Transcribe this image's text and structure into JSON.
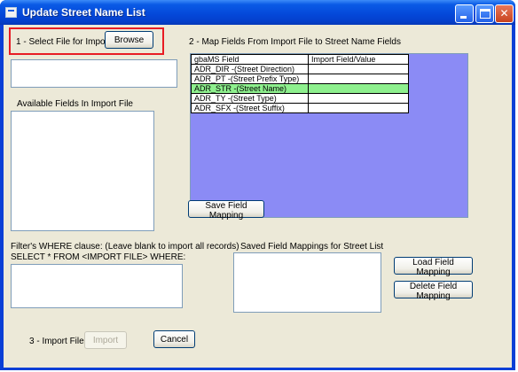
{
  "window": {
    "title": "Update Street Name List"
  },
  "step1": {
    "label": "1 - Select File for Import:",
    "browse_label": "Browse",
    "file_value": ""
  },
  "step2": {
    "label": "2 - Map Fields From Import File to  Street Name Fields"
  },
  "available_fields": {
    "label": "Available Fields In Import File",
    "items": []
  },
  "grid": {
    "headers": [
      "gbaMS Field",
      "Import Field/Value"
    ],
    "rows": [
      {
        "field": "ADR_DIR -(Street Direction)",
        "value": ""
      },
      {
        "field": "ADR_PT -(Street Prefix Type)",
        "value": ""
      },
      {
        "field": "ADR_STR -(Street Name)",
        "value": "",
        "selected": true
      },
      {
        "field": "ADR_TY -(Street Type)",
        "value": ""
      },
      {
        "field": "ADR_SFX -(Street Suffix)",
        "value": ""
      }
    ]
  },
  "save_mapping_label": "Save Field Mapping",
  "filter": {
    "label": "Filter's WHERE clause:  (Leave blank to import all records)",
    "sql_prefix": "SELECT * FROM <IMPORT FILE> WHERE:",
    "value": ""
  },
  "saved_mappings": {
    "label": "Saved Field Mappings for  Street List",
    "items": []
  },
  "load_mapping_label": "Load Field Mapping",
  "delete_mapping_label": "Delete Field Mapping",
  "step3": {
    "label": "3 - Import File",
    "import_label": "Import",
    "cancel_label": "Cancel"
  },
  "colors": {
    "grid_background": "#8b8bf5",
    "selected_row": "#8ef08e",
    "highlight_border": "#e81c24"
  },
  "icons": {
    "app": "app-icon",
    "minimize": "minimize-icon",
    "maximize": "maximize-icon",
    "close": "close-icon"
  }
}
